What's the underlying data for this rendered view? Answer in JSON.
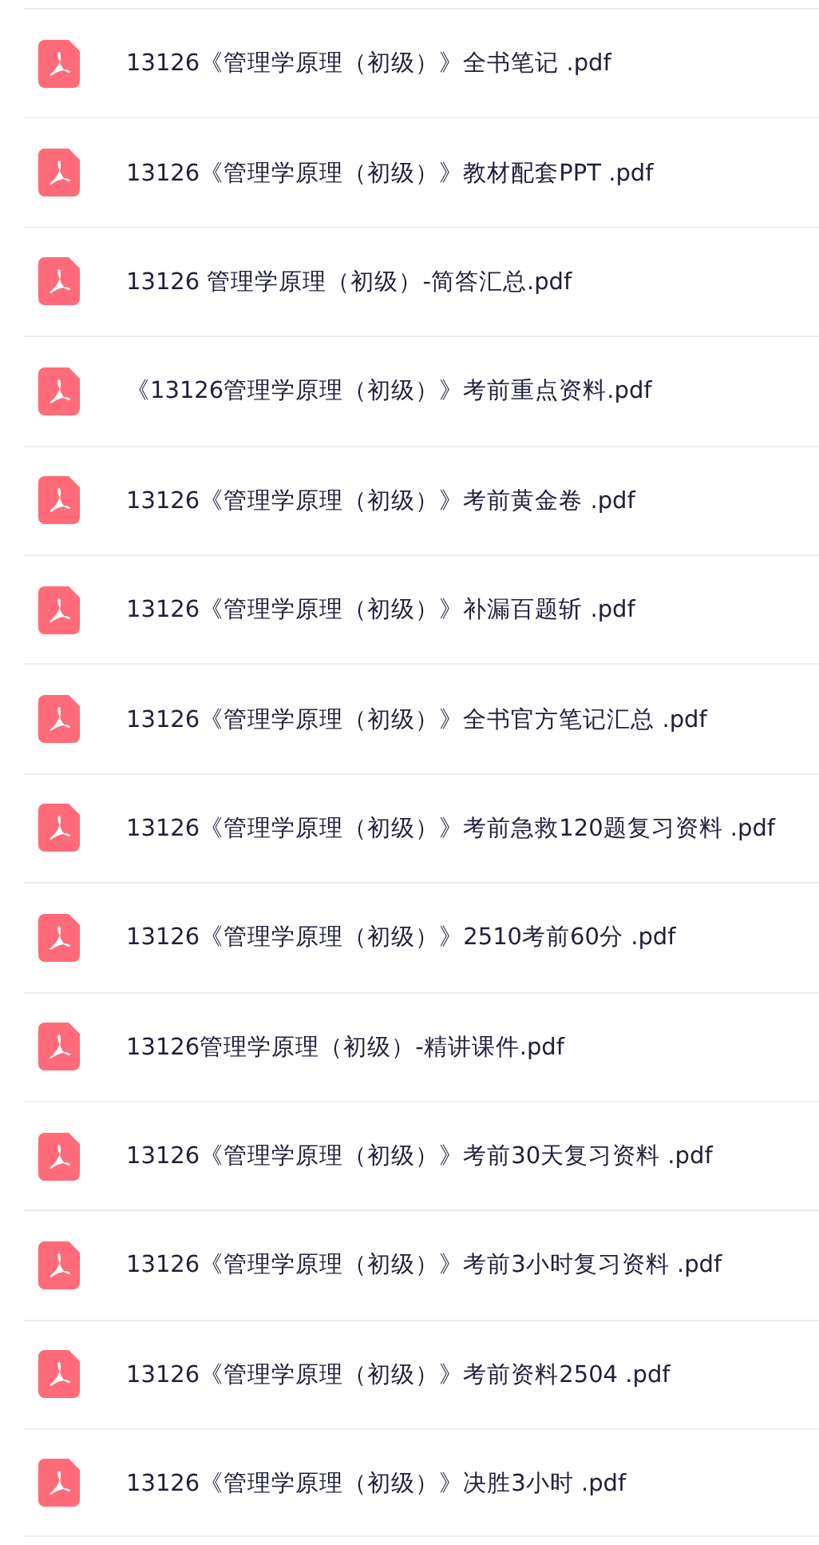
{
  "files": [
    {
      "name": "13126《管理学原理（初级）》全书笔记 .pdf"
    },
    {
      "name": "13126《管理学原理（初级）》教材配套PPT .pdf"
    },
    {
      "name": "13126 管理学原理（初级）-简答汇总.pdf"
    },
    {
      "name": "《13126管理学原理（初级）》考前重点资料.pdf"
    },
    {
      "name": "13126《管理学原理（初级）》考前黄金卷 .pdf"
    },
    {
      "name": "13126《管理学原理（初级）》补漏百题斩 .pdf"
    },
    {
      "name": "13126《管理学原理（初级）》全书官方笔记汇总 .pdf"
    },
    {
      "name": "13126《管理学原理（初级）》考前急救120题复习资料 .pdf"
    },
    {
      "name": "13126《管理学原理（初级）》2510考前60分 .pdf"
    },
    {
      "name": "13126管理学原理（初级）-精讲课件.pdf"
    },
    {
      "name": "13126《管理学原理（初级）》考前30天复习资料 .pdf"
    },
    {
      "name": "13126《管理学原理（初级）》考前3小时复习资料 .pdf"
    },
    {
      "name": "13126《管理学原理（初级）》考前资料2504 .pdf"
    },
    {
      "name": "13126《管理学原理（初级）》决胜3小时 .pdf"
    }
  ]
}
